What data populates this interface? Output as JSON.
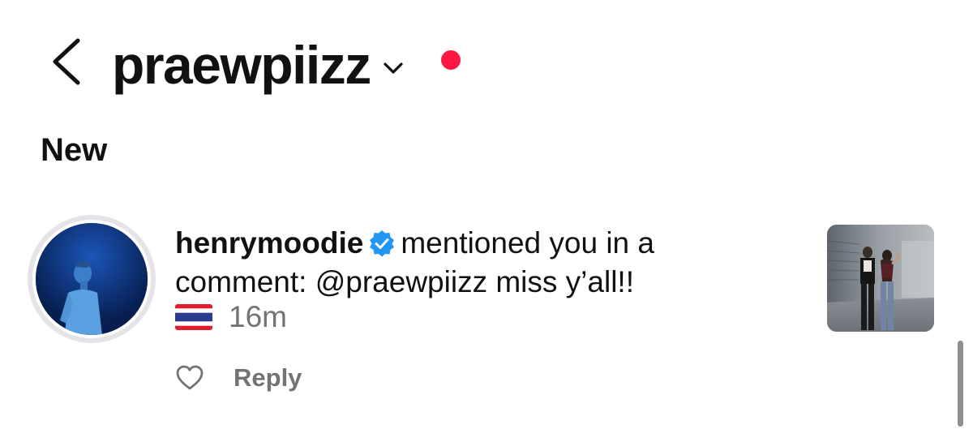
{
  "header": {
    "back_icon": "chevron-left-icon",
    "account_name": "praewpiizz",
    "switch_icon": "chevron-down-icon",
    "notification_dot_color": "#ff1744"
  },
  "section": {
    "title": "New"
  },
  "notification": {
    "username": "henrymoodie",
    "verified": true,
    "verified_icon": "verified-badge-icon",
    "verified_color": "#2196f3",
    "action_text": "mentioned you in a comment:",
    "mention": "@praewpiizz",
    "comment_text": "miss y’all!!",
    "flag_icon": "thailand-flag-icon",
    "time": "16m",
    "like_icon": "heart-outline-icon",
    "reply_label": "Reply"
  },
  "colors": {
    "text_primary": "#111111",
    "text_secondary": "#737373"
  }
}
